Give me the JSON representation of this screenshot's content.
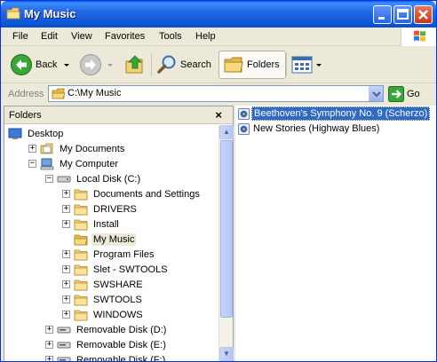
{
  "window": {
    "title": "My Music"
  },
  "menu": {
    "items": [
      "File",
      "Edit",
      "View",
      "Favorites",
      "Tools",
      "Help"
    ]
  },
  "toolbar": {
    "back_label": "Back",
    "search_label": "Search",
    "folders_label": "Folders"
  },
  "address": {
    "label": "Address",
    "value": "C:\\My Music",
    "go_label": "Go"
  },
  "folders_pane": {
    "title": "Folders",
    "close_glyph": "×",
    "tree": [
      {
        "label": "Desktop",
        "icon": "desktop-icon",
        "expander": "",
        "selected": false
      },
      {
        "label": "My Documents",
        "icon": "my-documents-icon",
        "expander": "+",
        "selected": false
      },
      {
        "label": "My Computer",
        "icon": "my-computer-icon",
        "expander": "−",
        "selected": false
      },
      {
        "label": "Local Disk (C:)",
        "icon": "drive-icon",
        "expander": "−",
        "selected": false
      },
      {
        "label": "Documents and Settings",
        "icon": "folder-icon",
        "expander": "+",
        "selected": false
      },
      {
        "label": "DRIVERS",
        "icon": "folder-icon",
        "expander": "+",
        "selected": false
      },
      {
        "label": "Install",
        "icon": "folder-icon",
        "expander": "+",
        "selected": false
      },
      {
        "label": "My Music",
        "icon": "open-folder-icon",
        "expander": "",
        "selected": true
      },
      {
        "label": "Program Files",
        "icon": "folder-icon",
        "expander": "+",
        "selected": false
      },
      {
        "label": "Slet - SWTOOLS",
        "icon": "folder-icon",
        "expander": "+",
        "selected": false
      },
      {
        "label": "SWSHARE",
        "icon": "folder-icon",
        "expander": "+",
        "selected": false
      },
      {
        "label": "SWTOOLS",
        "icon": "folder-icon",
        "expander": "+",
        "selected": false
      },
      {
        "label": "WINDOWS",
        "icon": "folder-icon",
        "expander": "+",
        "selected": false
      },
      {
        "label": "Removable Disk (D:)",
        "icon": "removable-drive-icon",
        "expander": "+",
        "selected": false
      },
      {
        "label": "Removable Disk (E:)",
        "icon": "removable-drive-icon",
        "expander": "+",
        "selected": false
      },
      {
        "label": "Removable Disk (F:)",
        "icon": "removable-drive-icon",
        "expander": "+",
        "selected": false
      }
    ]
  },
  "files": [
    {
      "name": "Beethoven's Symphony No. 9 (Scherzo)",
      "icon": "audio-file-icon",
      "selected": true
    },
    {
      "name": "New Stories (Highway Blues)",
      "icon": "audio-file-icon",
      "selected": false
    }
  ],
  "colors": {
    "titlebar": "#0a5ee8",
    "selection": "#316ac5",
    "chrome": "#ece9d8"
  }
}
